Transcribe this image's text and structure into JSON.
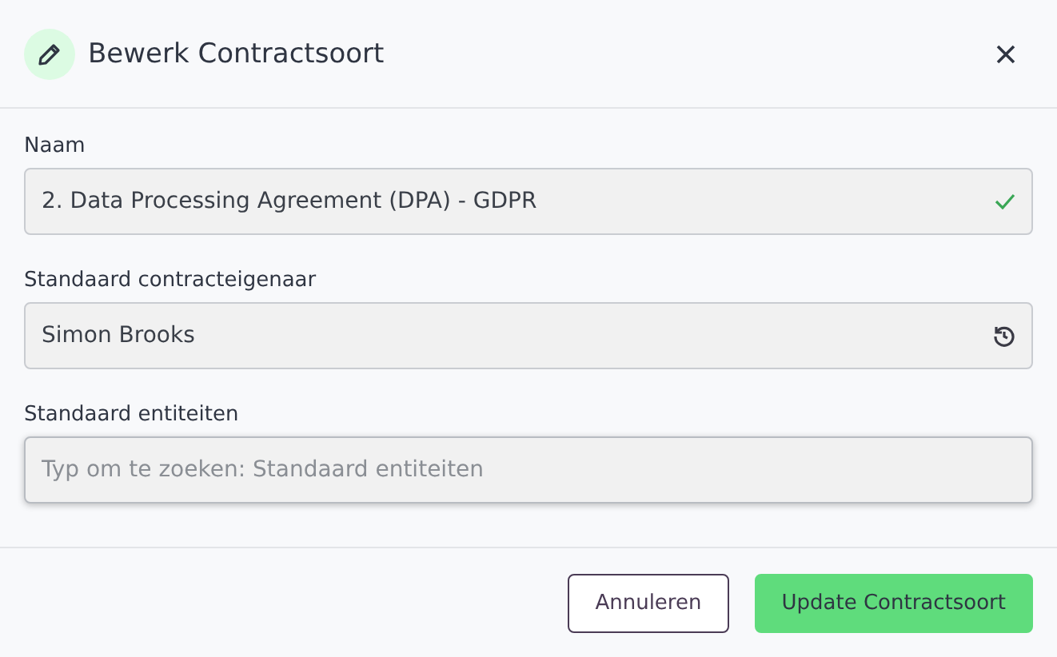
{
  "dialog": {
    "title": "Bewerk Contractsoort"
  },
  "fields": [
    {
      "label": "Naam",
      "value": "2. Data Processing Agreement (DPA) - GDPR",
      "kind": "valid",
      "focused": false
    },
    {
      "label": "Standaard contracteigenaar",
      "value": "Simon Brooks",
      "kind": "reset",
      "focused": false
    },
    {
      "label": "Standaard entiteiten",
      "placeholder": "Typ om te zoeken: Standaard entiteiten",
      "kind": "search",
      "focused": true
    }
  ],
  "buttons": [
    {
      "label": "Annuleren",
      "kind": "secondary"
    },
    {
      "label": "Update Contractsoort",
      "kind": "primary"
    }
  ]
}
